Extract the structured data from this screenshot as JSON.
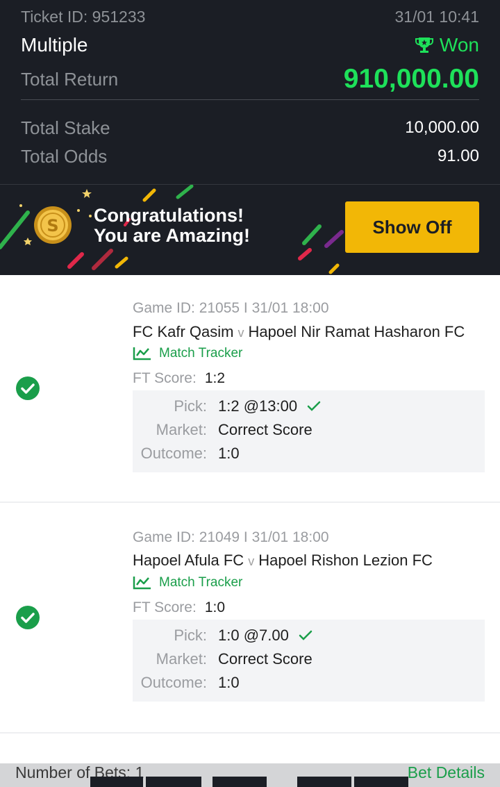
{
  "ticket": {
    "id_label": "Ticket ID: 951233",
    "datetime": "31/01 10:41",
    "type": "Multiple",
    "status": "Won",
    "return_label": "Total Return",
    "return_value": "910,000.00",
    "stake_label": "Total Stake",
    "stake_value": "10,000.00",
    "odds_label": "Total Odds",
    "odds_value": "91.00"
  },
  "banner": {
    "line1": "Congratulations!",
    "line2": "You are Amazing!",
    "button": "Show Off"
  },
  "bets": [
    {
      "meta": "Game ID: 21055 I 31/01 18:00",
      "home": "FC Kafr Qasim",
      "vs": "v",
      "away": "Hapoel Nir Ramat Hasharon FC",
      "tracker": "Match Tracker",
      "ft_label": "FT Score:",
      "ft_value": "1:2",
      "pick_label": "Pick:",
      "pick_value": "1:2 @13:00",
      "market_label": "Market:",
      "market_value": "Correct Score",
      "outcome_label": "Outcome:",
      "outcome_value": "1:0"
    },
    {
      "meta": "Game ID: 21049 I 31/01 18:00",
      "home": "Hapoel Afula FC",
      "vs": "v",
      "away": "Hapoel Rishon Lezion FC",
      "tracker": "Match Tracker",
      "ft_label": "FT Score:",
      "ft_value": "1:0",
      "pick_label": "Pick:",
      "pick_value": "1:0 @7.00",
      "market_label": "Market:",
      "market_value": "Correct Score",
      "outcome_label": "Outcome:",
      "outcome_value": "1:0"
    }
  ],
  "footer": {
    "bets_count": "Number of Bets: 1",
    "details": "Bet Details"
  },
  "colors": {
    "header_bg": "#1b1e25",
    "win_green": "#1ee15a",
    "accent_green": "#1a9e4a",
    "button_yellow": "#f2b706"
  },
  "icons": [
    "trophy-icon",
    "coin-icon",
    "check-circle-icon",
    "chart-line-icon",
    "checkmark-icon"
  ]
}
